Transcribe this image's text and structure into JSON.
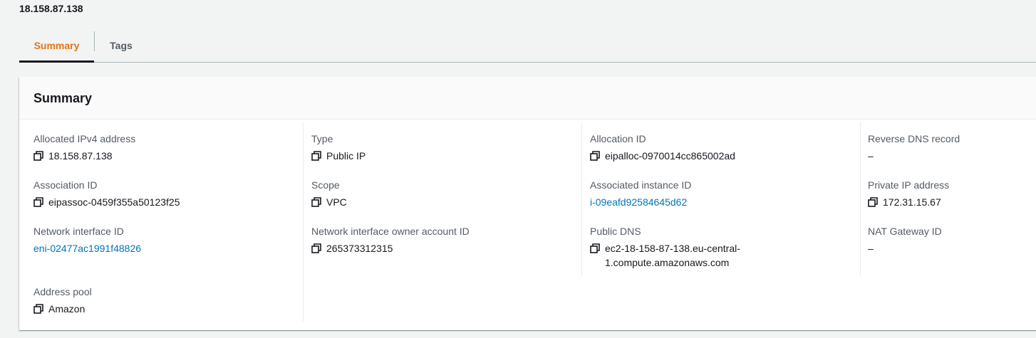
{
  "header": {
    "title": "18.158.87.138"
  },
  "tabs": [
    {
      "label": "Summary"
    },
    {
      "label": "Tags"
    }
  ],
  "panel": {
    "title": "Summary",
    "columns": [
      [
        {
          "label": "Allocated IPv4 address",
          "value": "18.158.87.138"
        },
        {
          "label": "Association ID",
          "value": "eipassoc-0459f355a50123f25"
        },
        {
          "label": "Network interface ID",
          "value": "eni-02477ac1991f48826"
        },
        {
          "label": "Address pool",
          "value": "Amazon"
        }
      ],
      [
        {
          "label": "Type",
          "value": "Public IP"
        },
        {
          "label": "Scope",
          "value": "VPC"
        },
        {
          "label": "Network interface owner account ID",
          "value": "265373312315"
        }
      ],
      [
        {
          "label": "Allocation ID",
          "value": "eipalloc-0970014cc865002ad"
        },
        {
          "label": "Associated instance ID",
          "value": "i-09eafd92584645d62"
        },
        {
          "label": "Public DNS",
          "value": "ec2-18-158-87-138.eu-central-1.compute.amazonaws.com"
        }
      ],
      [
        {
          "label": "Reverse DNS record",
          "value": "–"
        },
        {
          "label": "Private IP address",
          "value": "172.31.15.67"
        },
        {
          "label": "NAT Gateway ID",
          "value": "–"
        }
      ]
    ]
  },
  "icons": {
    "copy": "copy-icon"
  },
  "colors": {
    "active_tab": "#ec7211",
    "link": "#0073bb"
  }
}
